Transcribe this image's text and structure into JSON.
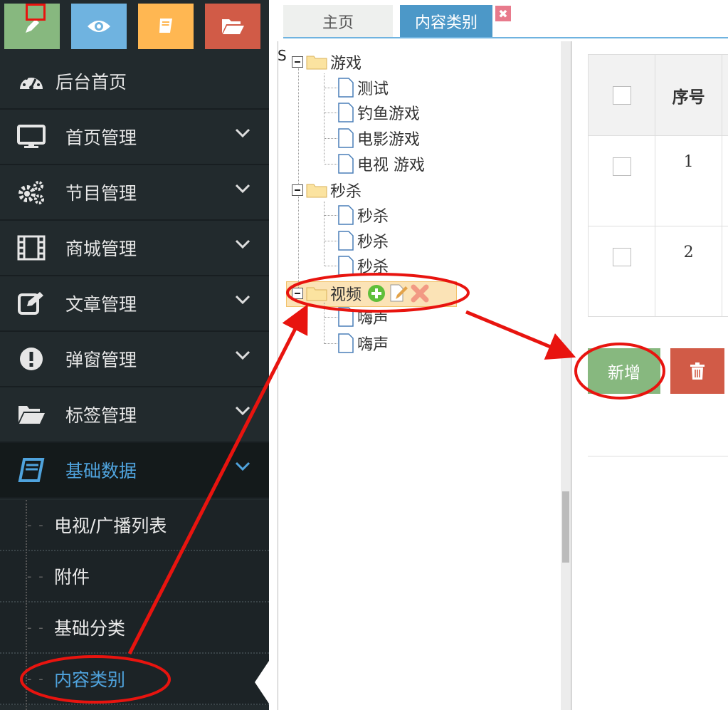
{
  "sidebar": {
    "shortcuts": [
      "pencil-icon",
      "eye-icon",
      "book-icon",
      "folder-open-icon"
    ],
    "items": [
      {
        "label": "后台首页",
        "icon": "dashboard-icon"
      },
      {
        "label": "首页管理",
        "icon": "desktop-icon"
      },
      {
        "label": "节目管理",
        "icon": "cogs-icon"
      },
      {
        "label": "商城管理",
        "icon": "film-icon"
      },
      {
        "label": "文章管理",
        "icon": "edit-icon"
      },
      {
        "label": "弹窗管理",
        "icon": "exclamation-icon"
      },
      {
        "label": "标签管理",
        "icon": "folder-open-icon"
      },
      {
        "label": "基础数据",
        "icon": "book-icon",
        "active": true
      }
    ],
    "subitems": [
      "电视/广播列表",
      "附件",
      "基础分类",
      "内容类别"
    ],
    "active_color": "#4fa3dd"
  },
  "tabs": {
    "home": "主页",
    "active": "内容类别",
    "close": "✖"
  },
  "tree": {
    "root_marker": "S",
    "groups": [
      {
        "label": "游戏",
        "children": [
          "测试",
          "钓鱼游戏",
          "电影游戏",
          "电视 游戏"
        ]
      },
      {
        "label": "秒杀",
        "children": [
          "秒杀",
          "秒杀",
          "秒杀"
        ]
      },
      {
        "label": "视频",
        "children": [
          "嗨声",
          "嗨声"
        ]
      }
    ]
  },
  "grid": {
    "header": "序号",
    "rows": [
      "1",
      "2"
    ]
  },
  "buttons": {
    "add": "新增",
    "delete_icon": "trash-icon"
  },
  "colors": {
    "annotation": "#e8140f",
    "success": "#87b87f",
    "danger": "#d15b47"
  }
}
